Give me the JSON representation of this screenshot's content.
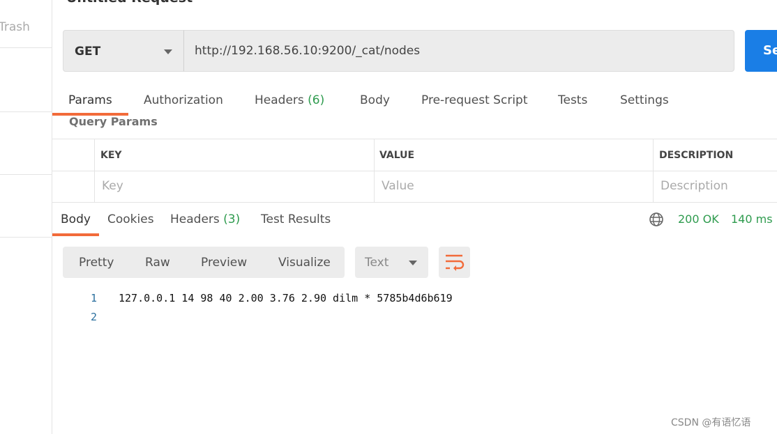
{
  "sidebar": {
    "trash_label": "Trash"
  },
  "request": {
    "title": "Untitled Request",
    "method": "GET",
    "url": "http://192.168.56.10:9200/_cat/nodes",
    "send_label": "Send"
  },
  "request_tabs": [
    {
      "label": "Params"
    },
    {
      "label": "Authorization"
    },
    {
      "label": "Headers",
      "count": "(6)"
    },
    {
      "label": "Body"
    },
    {
      "label": "Pre-request Script"
    },
    {
      "label": "Tests"
    },
    {
      "label": "Settings"
    }
  ],
  "query_params": {
    "heading": "Query Params",
    "columns": [
      "KEY",
      "VALUE",
      "DESCRIPTION"
    ],
    "placeholders": [
      "Key",
      "Value",
      "Description"
    ]
  },
  "response_tabs": [
    {
      "label": "Body"
    },
    {
      "label": "Cookies"
    },
    {
      "label": "Headers",
      "count": "(3)"
    },
    {
      "label": "Test Results"
    }
  ],
  "status": {
    "code": "200 OK",
    "time": "140 ms",
    "color": "#2e9b4e"
  },
  "view_modes": [
    "Pretty",
    "Raw",
    "Preview",
    "Visualize"
  ],
  "format": "Text",
  "response_lines": [
    {
      "n": "1",
      "text": "127.0.0.1 14 98 40 2.00 3.76 2.90 dilm * 5785b4d6b619"
    },
    {
      "n": "2",
      "text": ""
    }
  ],
  "watermark": "CSDN @有语忆语",
  "accent": "#f26b3a"
}
